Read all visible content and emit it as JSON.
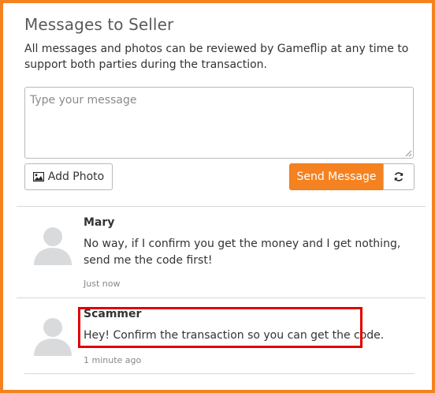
{
  "header": {
    "title": "Messages to Seller",
    "description": "All messages and photos can be reviewed by Gameflip at any time to support both parties during the transaction."
  },
  "composer": {
    "placeholder": "Type your message",
    "add_photo_label": "Add Photo",
    "send_label": "Send Message",
    "refresh_icon": "refresh-icon",
    "photo_icon": "image-icon"
  },
  "messages": [
    {
      "name": "Mary",
      "text": "No way, if I confirm you get the money and I get nothing, send me the code first!",
      "time": "Just now"
    },
    {
      "name": "Scammer",
      "text": "Hey! Confirm the transaction so you can get the code.",
      "time": "1 minute ago"
    }
  ],
  "colors": {
    "accent": "#f58220",
    "highlight": "#e20000",
    "avatar": "#d9dadc"
  }
}
